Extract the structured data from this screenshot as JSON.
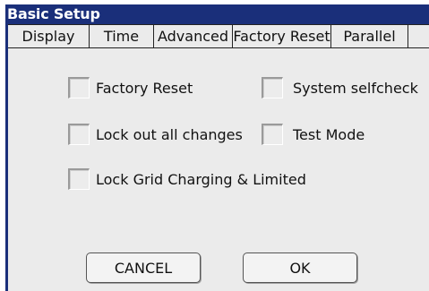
{
  "window": {
    "title": "Basic Setup"
  },
  "tabs": [
    {
      "label": "Display"
    },
    {
      "label": "Time"
    },
    {
      "label": "Advanced"
    },
    {
      "label": "Factory Reset"
    },
    {
      "label": "Parallel"
    }
  ],
  "active_tab": "Factory Reset",
  "options": {
    "factory_reset": {
      "label": "Factory Reset",
      "checked": false
    },
    "system_selfcheck": {
      "label": "System selfcheck",
      "checked": false
    },
    "lock_out_all_changes": {
      "label": "Lock out all changes",
      "checked": false
    },
    "test_mode": {
      "label": "Test Mode",
      "checked": false
    },
    "lock_grid_charging": {
      "label": "Lock Grid Charging & Limited",
      "checked": false
    }
  },
  "buttons": {
    "cancel_label": "CANCEL",
    "ok_label": "OK"
  },
  "colors": {
    "titlebar": "#1a2f7a",
    "background": "#ebebeb"
  }
}
